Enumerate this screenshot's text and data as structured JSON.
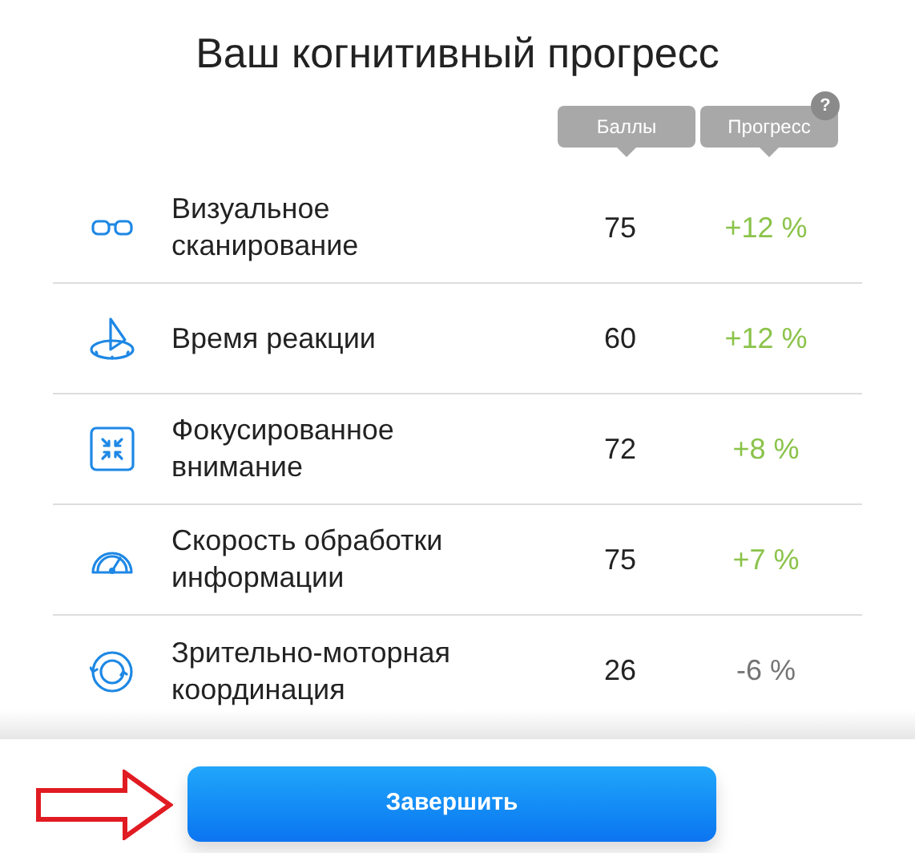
{
  "title": "Ваш когнитивный прогресс",
  "columns": [
    {
      "label": "Баллы"
    },
    {
      "label": "Прогресс",
      "help": "?"
    }
  ],
  "rows": [
    {
      "kind": "glasses",
      "name": "Визуальное сканирование",
      "score": "75",
      "progress": "+12 %",
      "color": "#8bc34a"
    },
    {
      "kind": "sundial",
      "name": "Время реакции",
      "score": "60",
      "progress": "+12 %",
      "color": "#8bc34a"
    },
    {
      "kind": "focus",
      "name": "Фокусированное внимание",
      "score": "72",
      "progress": "+8 %",
      "color": "#8bc34a"
    },
    {
      "kind": "gauge",
      "name": "Скорость обработки информации",
      "score": "75",
      "progress": "+7 %",
      "color": "#8bc34a"
    },
    {
      "kind": "cycle",
      "name": "Зрительно-моторная координация",
      "score": "26",
      "progress": "-6 %",
      "color": "#757575"
    }
  ],
  "button": "Завершить"
}
